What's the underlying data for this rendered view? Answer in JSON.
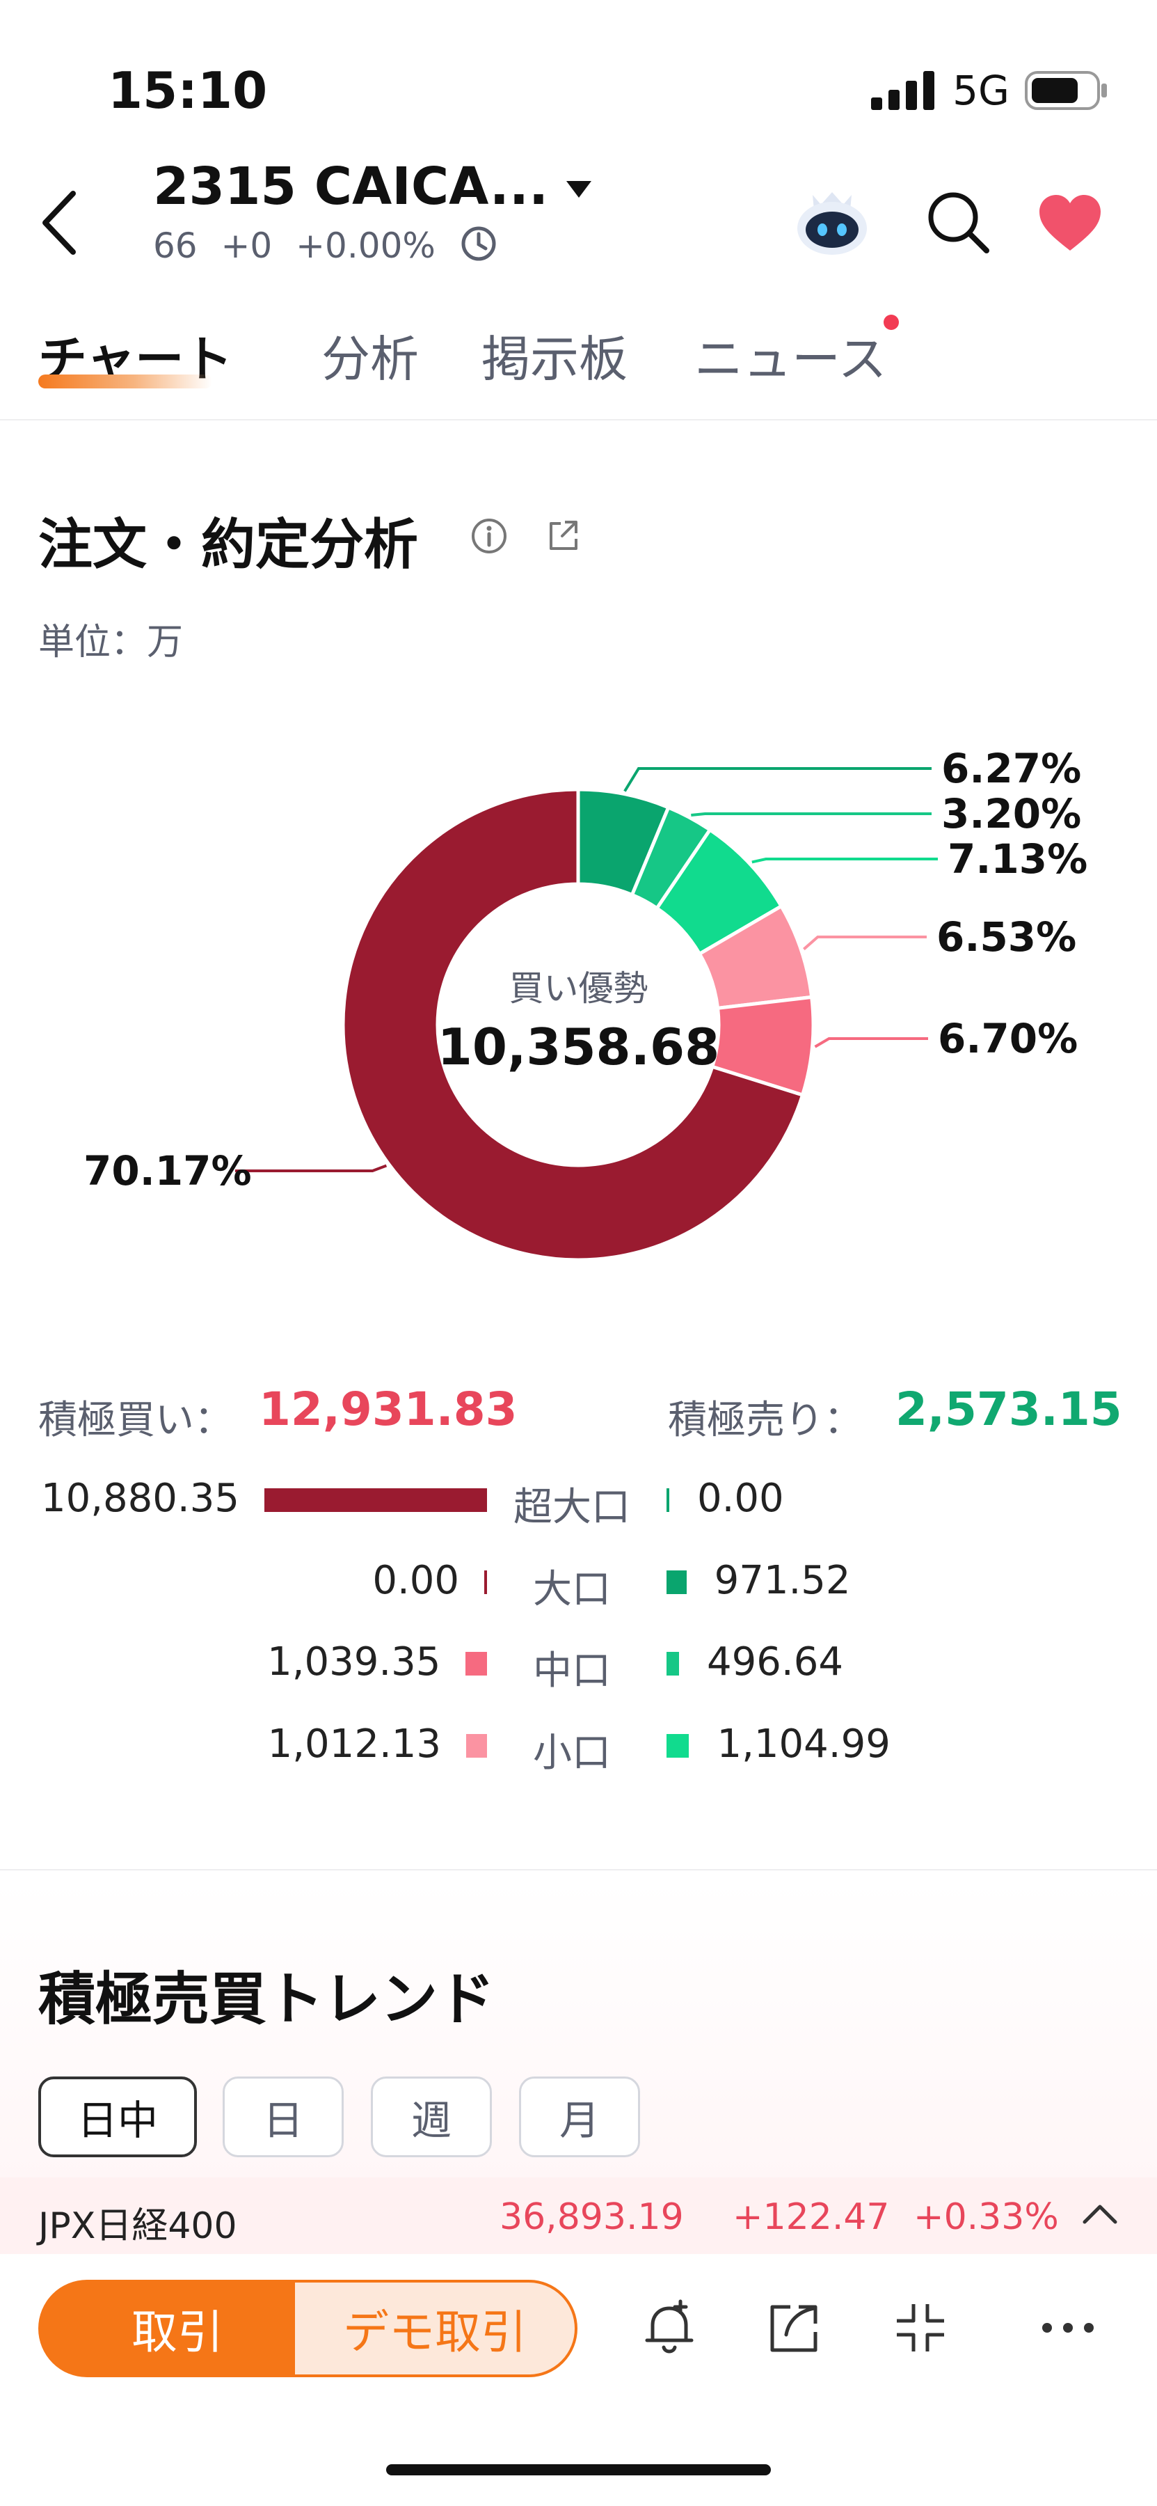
{
  "status_bar": {
    "time": "15:10",
    "network": "5G"
  },
  "header": {
    "stock_title": "2315  CAICA...",
    "price": "66",
    "change": "+0",
    "change_pct": "+0.00%"
  },
  "tabs": [
    {
      "label": "チャート",
      "active": true
    },
    {
      "label": "分析",
      "active": false
    },
    {
      "label": "掲示板",
      "active": false
    },
    {
      "label": "ニュース",
      "active": false,
      "badge": true
    }
  ],
  "analysis": {
    "title": "注文・約定分析",
    "unit": "単位：万",
    "center_label": "買い優勢",
    "center_value": "10,358.68",
    "buy_label": "積極買い：",
    "buy_total": "12,931.83",
    "sell_label": "積極売り：",
    "sell_total": "2,573.15",
    "rows": [
      {
        "size": "超大口",
        "buy": "10,880.35",
        "sell": "0.00",
        "buy_value": 10880.35,
        "sell_value": 0.0
      },
      {
        "size": "大口",
        "buy": "0.00",
        "sell": "971.52",
        "buy_value": 0.0,
        "sell_value": 971.52
      },
      {
        "size": "中口",
        "buy": "1,039.35",
        "sell": "496.64",
        "buy_value": 1039.35,
        "sell_value": 496.64
      },
      {
        "size": "小口",
        "buy": "1,012.13",
        "sell": "1,104.99",
        "buy_value": 1012.13,
        "sell_value": 1104.99
      }
    ]
  },
  "chart_data": {
    "type": "pie",
    "style": "donut",
    "slices": [
      {
        "label": "6.27%",
        "value": 6.27,
        "color": "#0aa56e"
      },
      {
        "label": "3.20%",
        "value": 3.2,
        "color": "#16c786"
      },
      {
        "label": "7.13%",
        "value": 7.13,
        "color": "#11db8e"
      },
      {
        "label": "6.53%",
        "value": 6.53,
        "color": "#fb93a2"
      },
      {
        "label": "6.70%",
        "value": 6.7,
        "color": "#f66a80"
      },
      {
        "label": "70.17%",
        "value": 70.17,
        "color": "#9a1b30"
      }
    ]
  },
  "colors": {
    "buy_dark": "#9a1b30",
    "buy_mid": "#f66a80",
    "buy_light": "#fb93a2",
    "sell_dark": "#0aa56e",
    "sell_mid": "#16c786",
    "sell_light": "#11db8e",
    "up_red": "#e8465b",
    "sell_text": "#10a870",
    "accent": "#f57617"
  },
  "trend": {
    "title": "積極売買トレンド",
    "periods": [
      {
        "label": "日中",
        "active": true
      },
      {
        "label": "日",
        "active": false
      },
      {
        "label": "週",
        "active": false
      },
      {
        "label": "月",
        "active": false
      }
    ]
  },
  "index_ticker": {
    "name": "JPX日経400",
    "value": "36,893.19",
    "change": "+122.47",
    "change_pct": "+0.33%"
  },
  "bottom_bar": {
    "trade_label": "取引",
    "demo_label": "デモ取引",
    "icons": [
      "bell-plus-icon",
      "share-icon",
      "collapse-icon",
      "more-icon"
    ]
  }
}
